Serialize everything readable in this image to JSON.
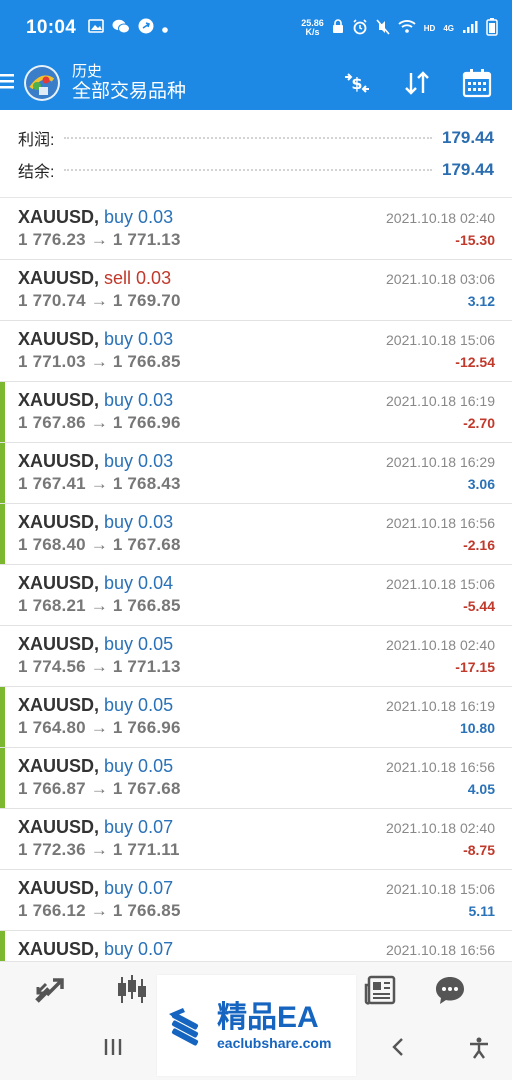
{
  "status": {
    "time": "10:04",
    "net_speed_value": "25.86",
    "net_speed_unit": "K/s",
    "hd_label": "HD",
    "network_label": "4G"
  },
  "header": {
    "title": "历史",
    "subtitle": "全部交易品种"
  },
  "summary": {
    "profit_label": "利润:",
    "profit_value": "179.44",
    "balance_label": "结余:",
    "balance_value": "179.44"
  },
  "trades": [
    {
      "symbol": "XAUUSD,",
      "side": "buy 0.03",
      "type": "buy",
      "prices": "1 776.23 → 1 771.13",
      "time": "2021.10.18 02:40",
      "profit": "-15.30",
      "sign": "neg",
      "marked": false
    },
    {
      "symbol": "XAUUSD,",
      "side": "sell 0.03",
      "type": "sell",
      "prices": "1 770.74 → 1 769.70",
      "time": "2021.10.18 03:06",
      "profit": "3.12",
      "sign": "pos",
      "marked": false
    },
    {
      "symbol": "XAUUSD,",
      "side": "buy 0.03",
      "type": "buy",
      "prices": "1 771.03 → 1 766.85",
      "time": "2021.10.18 15:06",
      "profit": "-12.54",
      "sign": "neg",
      "marked": false
    },
    {
      "symbol": "XAUUSD,",
      "side": "buy 0.03",
      "type": "buy",
      "prices": "1 767.86 → 1 766.96",
      "time": "2021.10.18 16:19",
      "profit": "-2.70",
      "sign": "neg",
      "marked": true
    },
    {
      "symbol": "XAUUSD,",
      "side": "buy 0.03",
      "type": "buy",
      "prices": "1 767.41 → 1 768.43",
      "time": "2021.10.18 16:29",
      "profit": "3.06",
      "sign": "pos",
      "marked": true
    },
    {
      "symbol": "XAUUSD,",
      "side": "buy 0.03",
      "type": "buy",
      "prices": "1 768.40 → 1 767.68",
      "time": "2021.10.18 16:56",
      "profit": "-2.16",
      "sign": "neg",
      "marked": true
    },
    {
      "symbol": "XAUUSD,",
      "side": "buy 0.04",
      "type": "buy",
      "prices": "1 768.21 → 1 766.85",
      "time": "2021.10.18 15:06",
      "profit": "-5.44",
      "sign": "neg",
      "marked": false
    },
    {
      "symbol": "XAUUSD,",
      "side": "buy 0.05",
      "type": "buy",
      "prices": "1 774.56 → 1 771.13",
      "time": "2021.10.18 02:40",
      "profit": "-17.15",
      "sign": "neg",
      "marked": false
    },
    {
      "symbol": "XAUUSD,",
      "side": "buy 0.05",
      "type": "buy",
      "prices": "1 764.80 → 1 766.96",
      "time": "2021.10.18 16:19",
      "profit": "10.80",
      "sign": "pos",
      "marked": true
    },
    {
      "symbol": "XAUUSD,",
      "side": "buy 0.05",
      "type": "buy",
      "prices": "1 766.87 → 1 767.68",
      "time": "2021.10.18 16:56",
      "profit": "4.05",
      "sign": "pos",
      "marked": true
    },
    {
      "symbol": "XAUUSD,",
      "side": "buy 0.07",
      "type": "buy",
      "prices": "1 772.36 → 1 771.11",
      "time": "2021.10.18 02:40",
      "profit": "-8.75",
      "sign": "neg",
      "marked": false
    },
    {
      "symbol": "XAUUSD,",
      "side": "buy 0.07",
      "type": "buy",
      "prices": "1 766.12 → 1 766.85",
      "time": "2021.10.18 15:06",
      "profit": "5.11",
      "sign": "pos",
      "marked": false
    },
    {
      "symbol": "XAUUSD,",
      "side": "buy 0.07",
      "type": "buy",
      "prices": "",
      "time": "2021.10.18 16:56",
      "profit": "",
      "sign": "pos",
      "marked": true
    }
  ],
  "bottom_nav": {
    "items": [
      "quotes-icon",
      "chart-icon",
      "trade-icon",
      "news-icon",
      "chat-icon"
    ]
  },
  "system_nav": {
    "items": [
      "recents-icon",
      "back-icon",
      "accessibility-icon"
    ]
  },
  "watermark": {
    "title": "精品EA",
    "url": "eaclubshare.com"
  },
  "colors": {
    "brand_blue": "#1e88e5",
    "buy_blue": "#2a72b8",
    "sell_red": "#c0392b",
    "marker_green": "#7cb82f"
  }
}
